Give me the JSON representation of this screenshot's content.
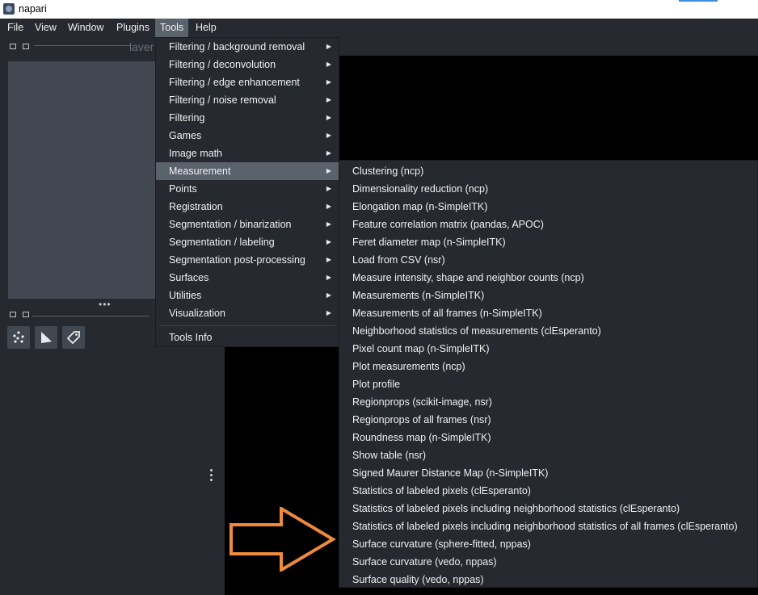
{
  "window": {
    "title": "napari"
  },
  "menubar": [
    {
      "label": "File"
    },
    {
      "label": "View"
    },
    {
      "label": "Window"
    },
    {
      "label": "Plugins"
    },
    {
      "label": "Tools"
    },
    {
      "label": "Help"
    }
  ],
  "layers_panel": {
    "title": "laver"
  },
  "tools_menu": {
    "items": [
      {
        "label": "Filtering / background removal"
      },
      {
        "label": "Filtering / deconvolution"
      },
      {
        "label": "Filtering / edge enhancement"
      },
      {
        "label": "Filtering / noise removal"
      },
      {
        "label": "Filtering"
      },
      {
        "label": "Games"
      },
      {
        "label": "Image math"
      },
      {
        "label": "Measurement"
      },
      {
        "label": "Points"
      },
      {
        "label": "Registration"
      },
      {
        "label": "Segmentation / binarization"
      },
      {
        "label": "Segmentation / labeling"
      },
      {
        "label": "Segmentation post-processing"
      },
      {
        "label": "Surfaces"
      },
      {
        "label": "Utilities"
      },
      {
        "label": "Visualization"
      }
    ],
    "info_label": "Tools Info"
  },
  "measurement_submenu": {
    "items": [
      "Clustering (ncp)",
      "Dimensionality reduction (ncp)",
      "Elongation map (n-SimpleITK)",
      "Feature correlation matrix (pandas, APOC)",
      "Feret diameter map (n-SimpleITK)",
      "Load from CSV (nsr)",
      "Measure intensity, shape and neighbor counts (ncp)",
      "Measurements (n-SimpleITK)",
      "Measurements of all frames (n-SimpleITK)",
      "Neighborhood statistics of measurements (clEsperanto)",
      "Pixel count map (n-SimpleITK)",
      "Plot measurements (ncp)",
      "Plot profile",
      "Regionprops (scikit-image, nsr)",
      "Regionprops of all frames (nsr)",
      "Roundness map (n-SimpleITK)",
      "Show table (nsr)",
      "Signed Maurer Distance Map (n-SimpleITK)",
      "Statistics of labeled pixels (clEsperanto)",
      "Statistics of labeled pixels including neighborhood statistics (clEsperanto)",
      "Statistics of labeled pixels including neighborhood statistics of all frames (clEsperanto)",
      "Surface curvature (sphere-fitted, nppas)",
      "Surface curvature (vedo, nppas)",
      "Surface quality (vedo, nppas)"
    ]
  },
  "colors": {
    "panel": "#262930",
    "highlight": "#5a626c",
    "layer_list": "#414851",
    "annotation_arrow": "#f08a3c"
  }
}
